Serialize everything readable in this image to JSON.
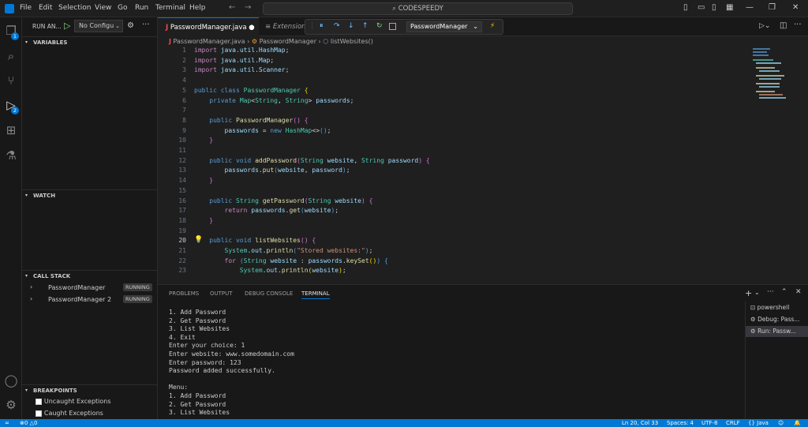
{
  "titlebar": {
    "menu": [
      "File",
      "Edit",
      "Selection",
      "View",
      "Go",
      "Run",
      "Terminal",
      "Help"
    ],
    "search": "CODESPEEDY"
  },
  "activity": {
    "explorer_badge": "1",
    "debug_badge": "2"
  },
  "sidebar": {
    "run_label": "RUN AN...",
    "config": "No Configu",
    "variables": "VARIABLES",
    "watch": "WATCH",
    "callstack": "CALL STACK",
    "threads": [
      {
        "name": "PasswordManager",
        "state": "RUNNING"
      },
      {
        "name": "PasswordManager 2",
        "state": "RUNNING"
      }
    ],
    "breakpoints": "BREAKPOINTS",
    "bp_items": [
      "Uncaught Exceptions",
      "Caught Exceptions"
    ]
  },
  "editor": {
    "tab_active": "PasswordManager.java",
    "tab_other": "Extension",
    "debug_target": "PasswordManager",
    "crumbs": [
      "PasswordManager.java",
      "PasswordManager",
      "listWebsites()"
    ],
    "line_numbers": [
      "1",
      "2",
      "3",
      "4",
      "5",
      "6",
      "7",
      "8",
      "9",
      "10",
      "11",
      "12",
      "13",
      "14",
      "15",
      "16",
      "17",
      "18",
      "19",
      "20",
      "21",
      "22",
      "23"
    ]
  },
  "panel": {
    "tabs": [
      "PROBLEMS",
      "OUTPUT",
      "DEBUG CONSOLE",
      "TERMINAL"
    ],
    "terminal_lines": [
      "1. Add Password",
      "2. Get Password",
      "3. List Websites",
      "4. Exit",
      "Enter your choice: 1",
      "Enter website: www.somedomain.com",
      "Enter password: 123",
      "Password added successfully.",
      "",
      "Menu:",
      "1. Add Password",
      "2. Get Password",
      "3. List Websites"
    ],
    "terminals": [
      "powershell",
      "Debug: Pass...",
      "Run: Passw..."
    ]
  },
  "status": {
    "errors": "0",
    "warnings": "0",
    "position": "Ln 20, Col 33",
    "spaces": "Spaces: 4",
    "encoding": "UTF-8",
    "eol": "CRLF",
    "language": "Java"
  }
}
